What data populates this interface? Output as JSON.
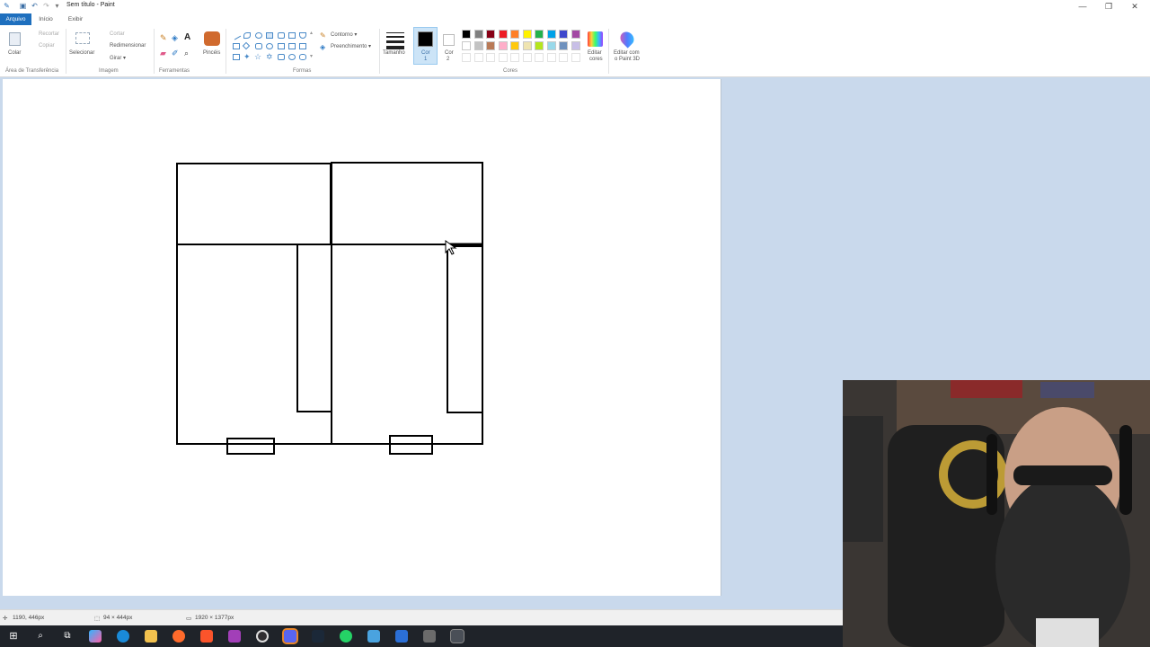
{
  "window": {
    "title": "Sem título - Paint",
    "controls": {
      "minimize": "—",
      "maximize": "❐",
      "close": "✕"
    }
  },
  "tabs": [
    {
      "label": "Arquivo",
      "active": true
    },
    {
      "label": "Início"
    },
    {
      "label": "Exibir"
    }
  ],
  "ribbon": {
    "clipboard": {
      "paste": "Colar",
      "cut": "Recortar",
      "copy": "Copiar",
      "group_label": "Área de Transferência"
    },
    "image": {
      "select": "Selecionar",
      "crop": "Cortar",
      "resize": "Redimensionar",
      "rotate": "Girar ▾",
      "group_label": "Imagem"
    },
    "tools": {
      "brushes": "Pincéis",
      "group_label": "Ferramentas"
    },
    "shapes": {
      "outline": "Contorno ▾",
      "fill": "Preenchimento ▾",
      "group_label": "Formas"
    },
    "size": {
      "label": "Tamanho"
    },
    "color1": {
      "label": "Cor",
      "sub": "1",
      "value": "#000000"
    },
    "color2": {
      "label": "Cor",
      "sub": "2",
      "value": "#ffffff"
    },
    "colors": {
      "group_label": "Cores",
      "row1": [
        "#000000",
        "#7f7f7f",
        "#880015",
        "#ed1c24",
        "#ff7f27",
        "#fff200",
        "#22b14c",
        "#00a2e8",
        "#3f48cc",
        "#a349a4"
      ],
      "row2": [
        "#ffffff",
        "#c3c3c3",
        "#b97a57",
        "#ffaec9",
        "#ffc90e",
        "#efe4b0",
        "#b5e61d",
        "#99d9ea",
        "#7092be",
        "#c8bfe7"
      ]
    },
    "edit_colors": {
      "line1": "Editar",
      "line2": "cores"
    },
    "edit_3d": {
      "line1": "Editar com",
      "line2": "o Paint 3D"
    }
  },
  "status": {
    "cursor_pos": "1190, 446px",
    "selection_size": "94 × 444px",
    "canvas_size": "1920 × 1377px"
  },
  "taskbar": {
    "icons": [
      "windows-start-icon",
      "search-icon",
      "task-view-icon",
      "copilot-icon",
      "edge-icon",
      "file-explorer-icon",
      "firefox-icon",
      "brave-icon",
      "app-icon",
      "obs-icon",
      "discord-icon",
      "steam-icon",
      "whatsapp-icon",
      "app-icon-2",
      "app-icon-3",
      "calculator-icon",
      "paint-icon"
    ]
  }
}
